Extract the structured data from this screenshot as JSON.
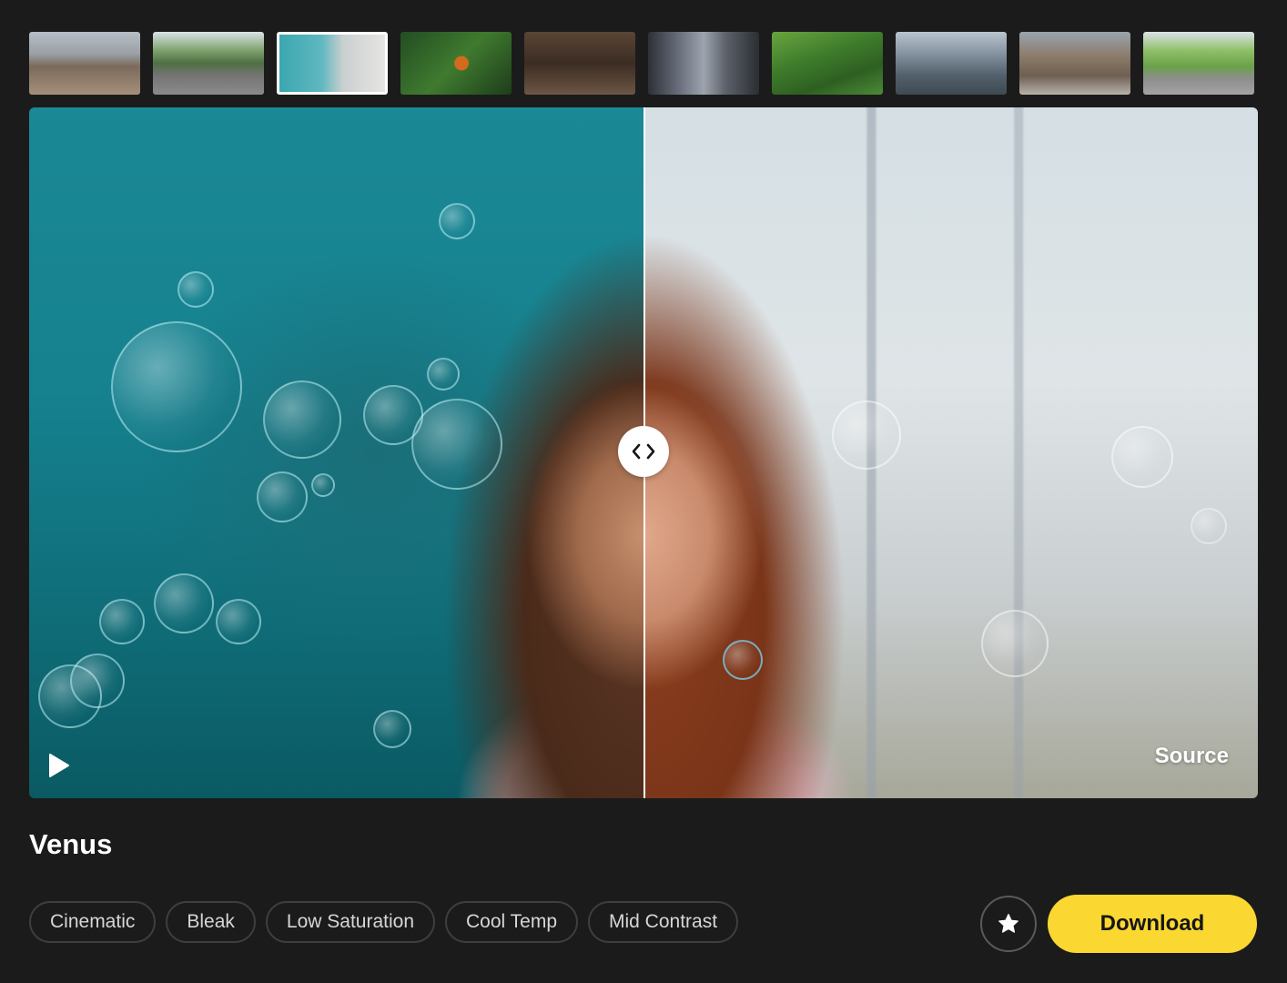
{
  "thumbnails": [
    {
      "icon": "desert-walker-thumbnail",
      "selected": false
    },
    {
      "icon": "red-car-road-thumbnail",
      "selected": false
    },
    {
      "icon": "woman-bubbles-thumbnail",
      "selected": true
    },
    {
      "icon": "butterfly-flowers-thumbnail",
      "selected": false
    },
    {
      "icon": "man-cafe-thumbnail",
      "selected": false
    },
    {
      "icon": "city-skyscrapers-thumbnail",
      "selected": false
    },
    {
      "icon": "person-grass-thumbnail",
      "selected": false
    },
    {
      "icon": "mountain-hiker-thumbnail",
      "selected": false
    },
    {
      "icon": "city-street-thumbnail",
      "selected": false
    },
    {
      "icon": "country-road-thumbnail",
      "selected": false
    }
  ],
  "viewer": {
    "source_label": "Source",
    "compare_split_percent": 50,
    "handle_icon": "compare-arrows-icon",
    "play_icon": "play-icon"
  },
  "preset": {
    "title": "Venus",
    "tags": [
      "Cinematic",
      "Bleak",
      "Low Saturation",
      "Cool Temp",
      "Mid Contrast"
    ]
  },
  "actions": {
    "favorite_icon": "star-icon",
    "download_label": "Download"
  },
  "colors": {
    "background": "#1b1b1b",
    "accent": "#fbd732",
    "tag_border": "#3e3e3e"
  }
}
